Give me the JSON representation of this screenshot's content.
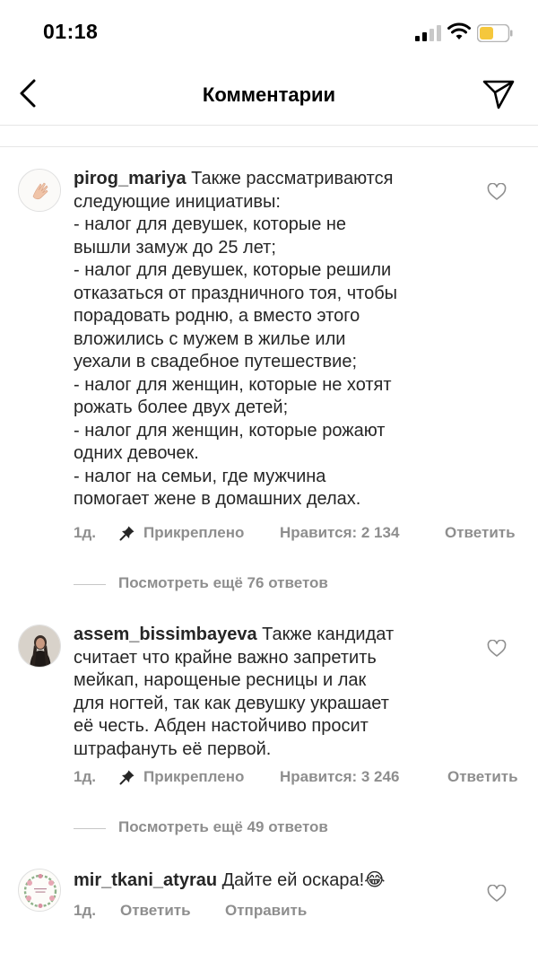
{
  "status_bar": {
    "time": "01:18"
  },
  "header": {
    "title": "Комментарии"
  },
  "comments": [
    {
      "username": "pirog_mariya",
      "lines": [
        "Также рассматриваются",
        "следующие инициативы:",
        "- налог для девушек, которые не",
        "вышли замуж до 25 лет;",
        "- налог для девушек, которые решили",
        "отказаться от праздничного тоя, чтобы",
        "порадовать родню, а вместо этого",
        "вложились с мужем в жилье или",
        "уехали в свадебное путешествие;",
        "- налог для женщин, которые не хотят",
        "рожать более двух детей;",
        "- налог для женщин, которые рожают",
        "одних девочек.",
        "- налог на семьи, где мужчина",
        "помогает жене в домашних делах."
      ],
      "time": "1д.",
      "pinned": "Прикреплено",
      "likes": "Нравится: 2 134",
      "reply": "Ответить",
      "more_replies": "Посмотреть ещё 76 ответов"
    },
    {
      "username": "assem_bissimbayeva",
      "lines": [
        "Также кандидат",
        "считает что крайне важно запретить",
        "мейкап, нарощеные  ресницы и лак",
        "для ногтей, так как девушку украшает",
        "её честь. Абден  настойчиво просит",
        "штрафануть  её первой."
      ],
      "time": "1д.",
      "pinned": "Прикреплено",
      "likes": "Нравится: 3 246",
      "reply": "Ответить",
      "more_replies": "Посмотреть ещё 49 ответов"
    },
    {
      "username": "mir_tkani_atyrau",
      "text": "Дайте ей оскара!😂",
      "time": "1д.",
      "reply": "Ответить",
      "send": "Отправить"
    }
  ],
  "colors": {
    "text": "#262626",
    "secondary": "#8e8e8e",
    "battery": "#f5c73c",
    "divider": "#e6e6e6"
  }
}
